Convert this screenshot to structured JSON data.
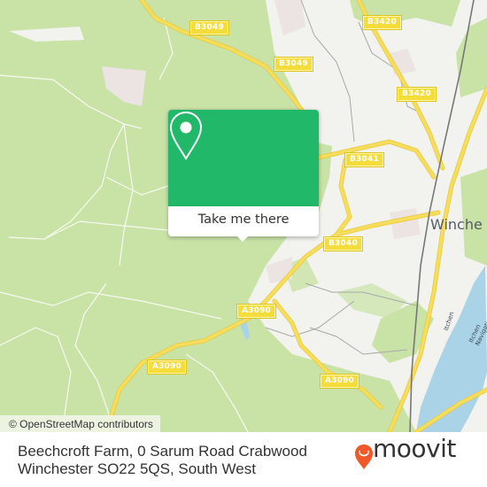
{
  "map": {
    "colors": {
      "land": "#c9e2a6",
      "urban": "#f2f2ee",
      "built": "#ece4e2",
      "road": "#f6dd5c",
      "road_edge": "#e8c93a",
      "water": "#aad3e8",
      "rail": "#777777"
    },
    "road_labels": [
      {
        "id": "b3049-top",
        "text": "B3049"
      },
      {
        "id": "b3049-mid",
        "text": "B3049"
      },
      {
        "id": "b3420-top",
        "text": "B3420"
      },
      {
        "id": "b3420-mid",
        "text": "B3420"
      },
      {
        "id": "b3041",
        "text": "B3041"
      },
      {
        "id": "b3040",
        "text": "B3040"
      },
      {
        "id": "a3090-top",
        "text": "A3090"
      },
      {
        "id": "a3090-left",
        "text": "A3090"
      },
      {
        "id": "a3090-right",
        "text": "A3090"
      }
    ],
    "place_labels": [
      {
        "id": "winchester",
        "text": "Winche"
      }
    ],
    "river_labels": [
      {
        "id": "itchen",
        "text": "Itchen"
      },
      {
        "id": "itchen-navigation",
        "text": "Itchen Navigation"
      }
    ],
    "attribution": "© OpenStreetMap contributors"
  },
  "popup": {
    "icon": "map-pin-icon",
    "button_label": "Take me there",
    "accent": "#21b86a"
  },
  "footer": {
    "address_line1": "Beechcroft Farm, 0 Sarum Road Crabwood",
    "address_line2": "Winchester SO22 5QS, South West",
    "brand": "moovit",
    "brand_color": "#f2592a"
  }
}
